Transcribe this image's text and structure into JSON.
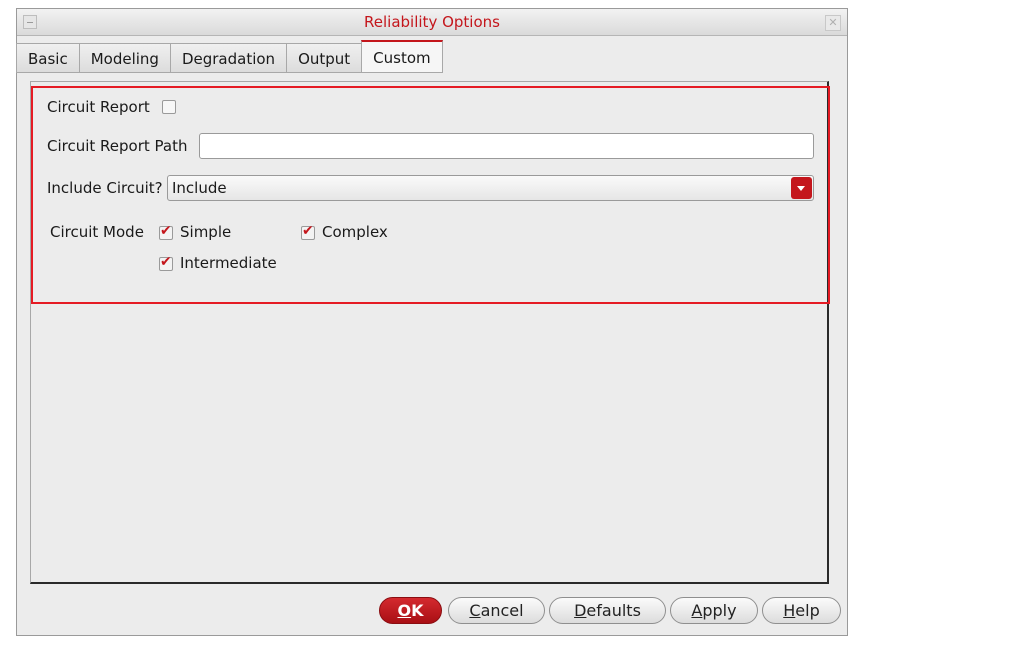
{
  "window": {
    "title": "Reliability Options",
    "close_glyph": "✕"
  },
  "tabs": [
    {
      "label": "Basic",
      "active": false
    },
    {
      "label": "Modeling",
      "active": false
    },
    {
      "label": "Degradation",
      "active": false
    },
    {
      "label": "Output",
      "active": false
    },
    {
      "label": "Custom",
      "active": true
    }
  ],
  "custom": {
    "circuit_report": {
      "label": "Circuit Report",
      "checked": false
    },
    "circuit_report_path": {
      "label": "Circuit Report Path",
      "value": ""
    },
    "include_circuit": {
      "label": "Include Circuit?",
      "value": "Include"
    },
    "circuit_mode": {
      "label": "Circuit Mode",
      "options": [
        {
          "label": "Simple",
          "checked": true
        },
        {
          "label": "Complex",
          "checked": true
        },
        {
          "label": "Intermediate",
          "checked": true
        }
      ]
    }
  },
  "buttons": {
    "ok": {
      "mnemonic": "O",
      "rest": "K"
    },
    "cancel": {
      "mnemonic": "C",
      "rest": "ancel"
    },
    "defaults": {
      "mnemonic": "D",
      "rest": "efaults"
    },
    "apply": {
      "mnemonic": "A",
      "rest": "pply"
    },
    "help": {
      "mnemonic": "H",
      "rest": "elp"
    }
  },
  "colors": {
    "accent": "#c4161c",
    "highlight": "#e51b24"
  },
  "icons": {
    "minimize": "minimize-icon",
    "close": "close-icon",
    "combo_arrow": "chevron-down-icon",
    "check": "checkmark-icon"
  }
}
